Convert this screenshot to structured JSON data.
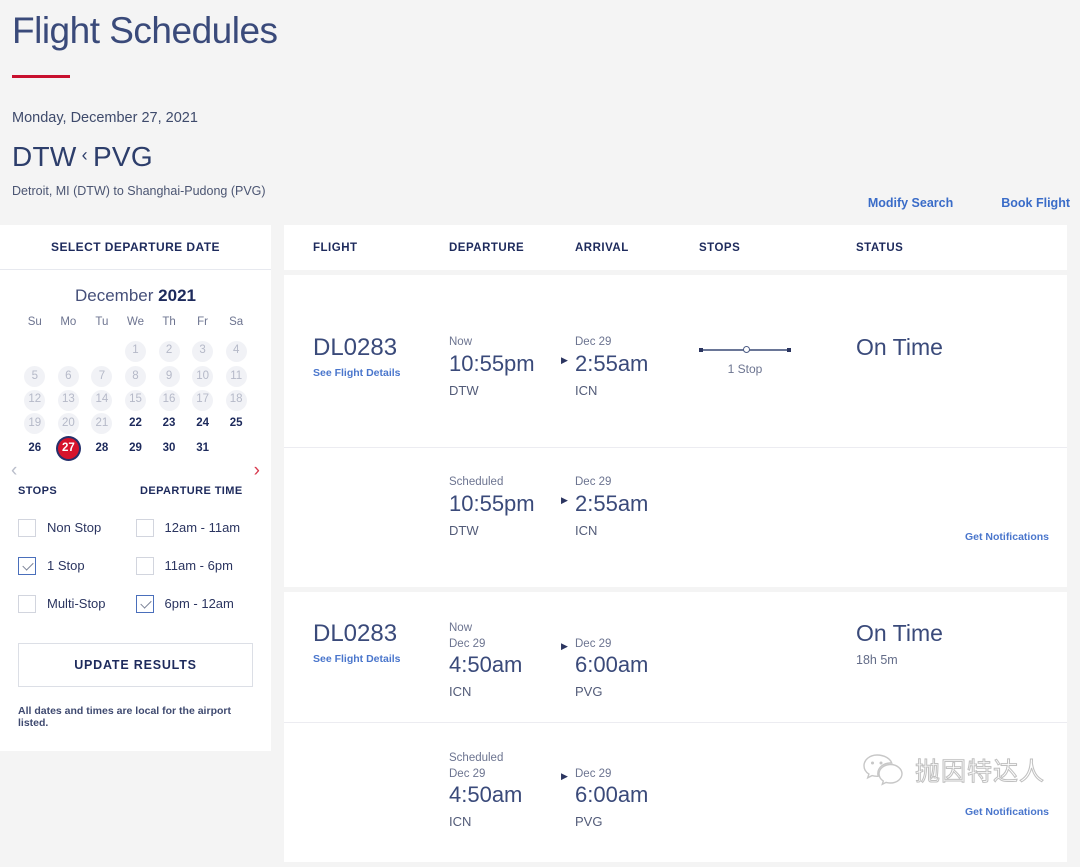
{
  "header": {
    "title": "Flight Schedules",
    "schedule_date": "Monday, December 27, 2021",
    "route_from": "DTW",
    "route_sep": "‹",
    "route_to": "PVG",
    "route_subtitle": "Detroit, MI (DTW) to Shanghai-Pudong (PVG)",
    "accent_color": "#c8102e",
    "link_color": "#3a6cc8"
  },
  "top_links": {
    "modify_search": "Modify Search",
    "book_flight": "Book Flight"
  },
  "sidebar": {
    "heading": "SELECT DEPARTURE DATE",
    "calendar": {
      "month": "December",
      "year": "2021",
      "weekdays": [
        "Su",
        "Mo",
        "Tu",
        "We",
        "Th",
        "Fr",
        "Sa"
      ],
      "prev_icon": "chevron-left",
      "next_icon": "chevron-right",
      "selected_day": 27,
      "weeks": [
        [
          null,
          null,
          null,
          1,
          2,
          3,
          4
        ],
        [
          5,
          6,
          7,
          8,
          9,
          10,
          11
        ],
        [
          12,
          13,
          14,
          15,
          16,
          17,
          18
        ],
        [
          19,
          20,
          21,
          22,
          23,
          24,
          25
        ],
        [
          26,
          27,
          28,
          29,
          30,
          31,
          null
        ]
      ],
      "disabled_days": [
        1,
        2,
        3,
        4,
        5,
        6,
        7,
        8,
        9,
        10,
        11,
        12,
        13,
        14,
        15,
        16,
        17,
        18,
        19,
        20,
        21
      ],
      "selected_bg": "#d6132c"
    },
    "filters": {
      "stops_heading": "STOPS",
      "departure_heading": "DEPARTURE TIME",
      "stops_options": [
        {
          "label": "Non Stop",
          "checked": false
        },
        {
          "label": "1 Stop",
          "checked": true
        },
        {
          "label": "Multi-Stop",
          "checked": false
        }
      ],
      "departure_options": [
        {
          "label": "12am - 11am",
          "checked": false
        },
        {
          "label": "11am - 6pm",
          "checked": false
        },
        {
          "label": "6pm - 12am",
          "checked": true
        }
      ]
    },
    "update_button": "UPDATE RESULTS",
    "note": "All dates and times are local for the airport listed."
  },
  "results": {
    "columns": {
      "flight": "FLIGHT",
      "departure": "DEPARTURE",
      "arrival": "ARRIVAL",
      "stops": "STOPS",
      "status": "STATUS"
    },
    "details_link": "See Flight Details",
    "notifications_link": "Get Notifications",
    "rows": [
      {
        "flight_number": "DL0283",
        "dep_label": "Now",
        "dep_date": "",
        "dep_time": "10:55pm",
        "dep_port": "DTW",
        "arr_label": "Dec 29",
        "arr_time": "2:55am",
        "arr_port": "ICN",
        "stops_caption": "1 Stop",
        "status": "On Time",
        "status_sub": ""
      },
      {
        "flight_number": "",
        "dep_label": "Scheduled",
        "dep_date": "",
        "dep_time": "10:55pm",
        "dep_port": "DTW",
        "arr_label": "Dec 29",
        "arr_time": "2:55am",
        "arr_port": "ICN",
        "stops_caption": "",
        "status": "",
        "status_sub": ""
      },
      {
        "flight_number": "DL0283",
        "dep_label": "Now",
        "dep_date": "Dec 29",
        "dep_time": "4:50am",
        "dep_port": "ICN",
        "arr_label": "Dec 29",
        "arr_time": "6:00am",
        "arr_port": "PVG",
        "stops_caption": "",
        "status": "On Time",
        "status_sub": "18h 5m"
      },
      {
        "flight_number": "",
        "dep_label": "Scheduled",
        "dep_date": "Dec 29",
        "dep_time": "4:50am",
        "dep_port": "ICN",
        "arr_label": "Dec 29",
        "arr_time": "6:00am",
        "arr_port": "PVG",
        "stops_caption": "",
        "status": "",
        "status_sub": ""
      }
    ]
  },
  "watermark": {
    "icon": "wechat-icon",
    "text": "抛因特达人"
  }
}
